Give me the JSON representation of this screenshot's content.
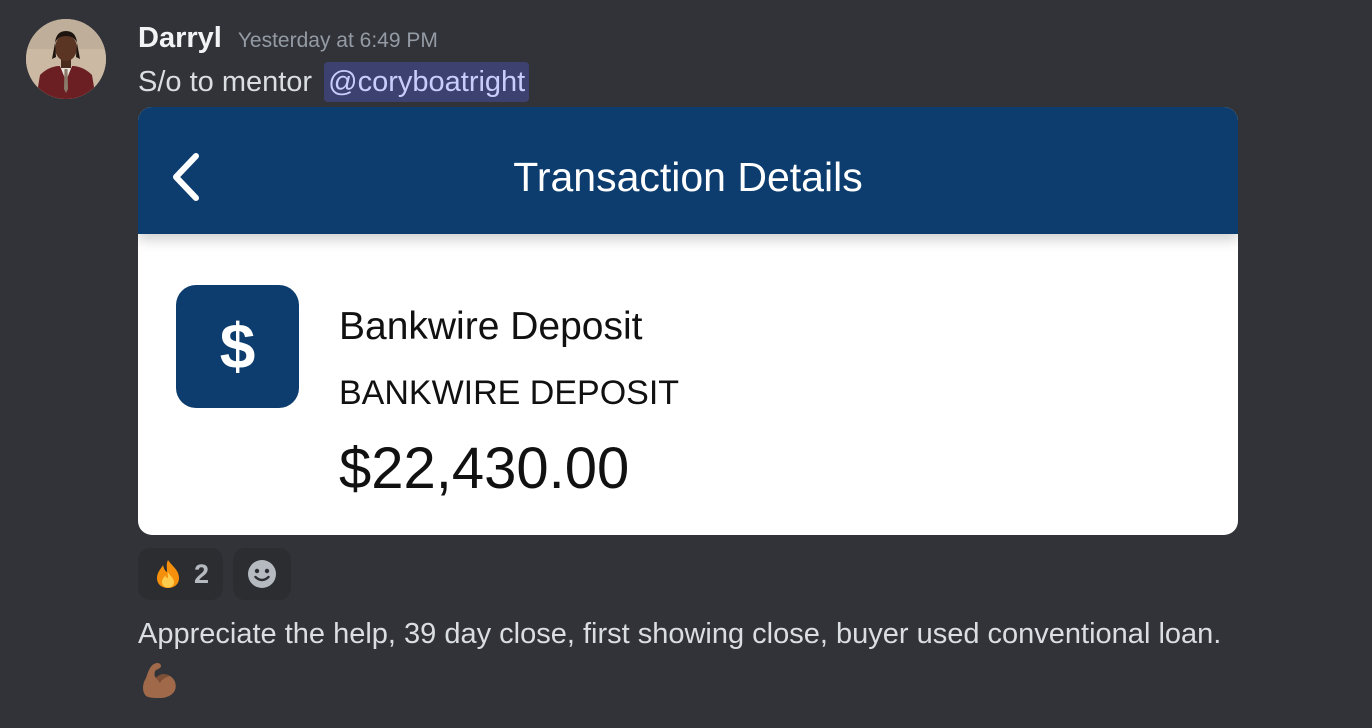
{
  "message": {
    "author": "Darryl",
    "timestamp": "Yesterday at 6:49 PM",
    "text_prefix": "S/o to mentor ",
    "mention": "@coryboatright",
    "followup_text": "Appreciate the help, 39 day close, first showing close, buyer used conventional loan."
  },
  "attachment": {
    "title": "Transaction Details",
    "icon_symbol": "$",
    "transaction_name": "Bankwire Deposit",
    "transaction_description": "BANKWIRE DEPOSIT",
    "amount": "$22,430.00",
    "colors": {
      "header": "#0c3d6e",
      "card": "#ffffff"
    }
  },
  "reactions": [
    {
      "emoji": "fire-emoji",
      "count": "2"
    },
    {
      "emoji": "add-reaction-icon"
    }
  ],
  "colors": {
    "background": "#313338",
    "mention_bg": "#3f4572",
    "mention_text": "#c9cdfb"
  }
}
